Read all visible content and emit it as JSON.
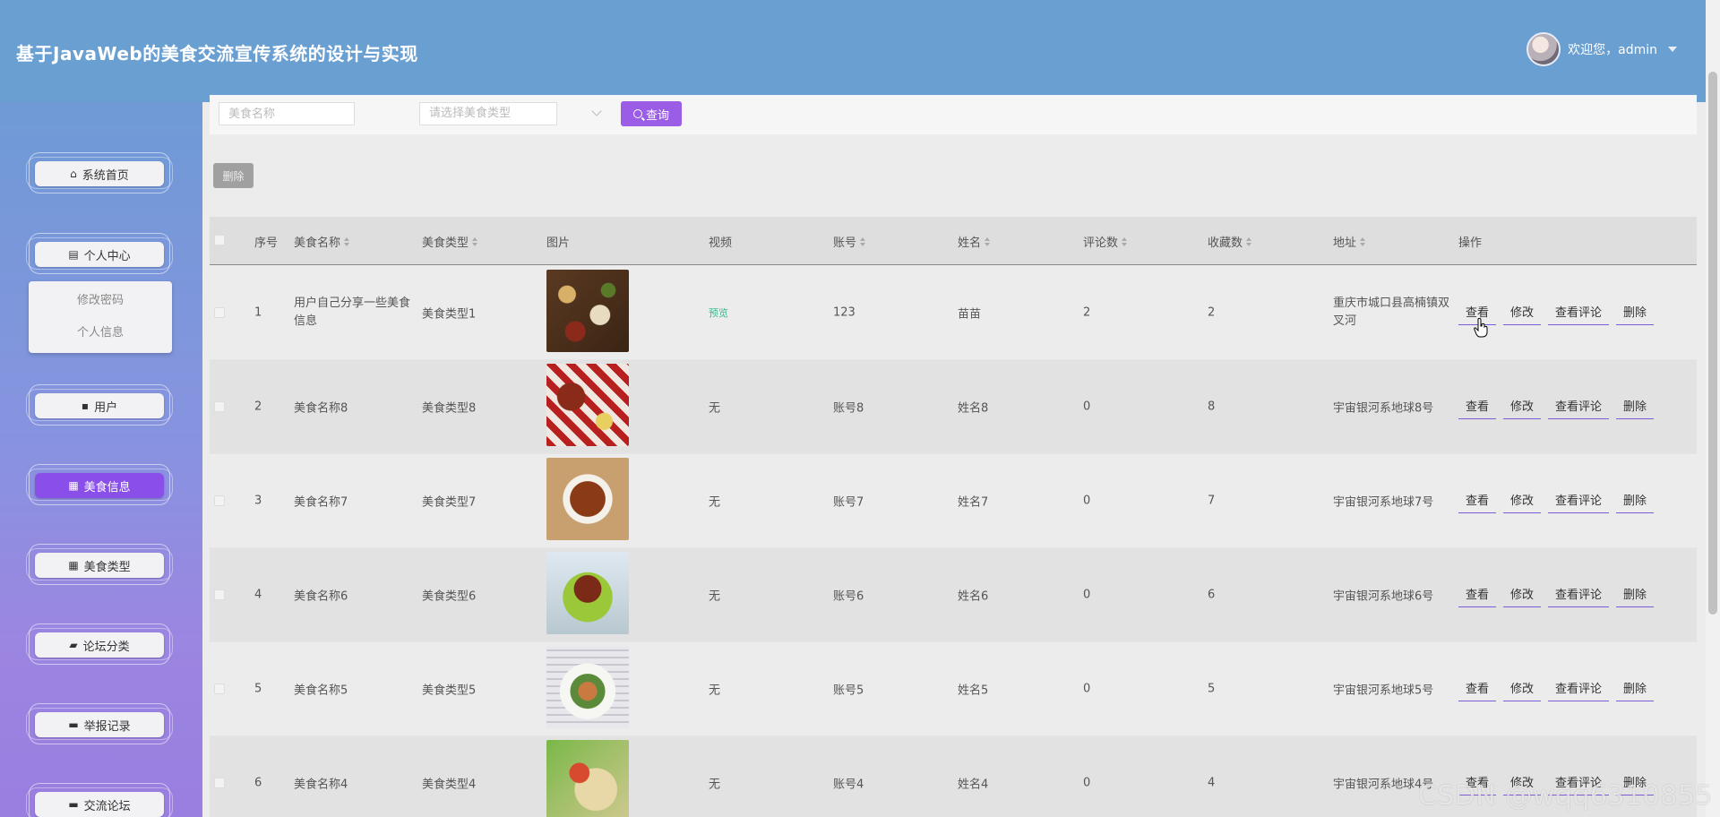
{
  "header": {
    "title": "基于JavaWeb的美食交流宣传系统的设计与实现",
    "welcome": "欢迎您，admin"
  },
  "sidebar": {
    "items": [
      {
        "label": "系统首页",
        "icon": "home-icon"
      },
      {
        "label": "个人中心",
        "icon": "card-icon"
      },
      {
        "label": "用户",
        "icon": "chat-icon"
      },
      {
        "label": "美食信息",
        "icon": "grid-icon",
        "active": true
      },
      {
        "label": "美食类型",
        "icon": "grid-icon"
      },
      {
        "label": "论坛分类",
        "icon": "thumb-icon"
      },
      {
        "label": "举报记录",
        "icon": "monitor-icon"
      },
      {
        "label": "交流论坛",
        "icon": "monitor-icon"
      }
    ],
    "submenu": [
      "修改密码",
      "个人信息"
    ]
  },
  "search": {
    "name_placeholder": "美食名称",
    "type_placeholder": "请选择美食类型",
    "query_label": "查询"
  },
  "toolbar": {
    "delete_label": "删除"
  },
  "table": {
    "headers": [
      "序号",
      "美食名称",
      "美食类型",
      "图片",
      "视频",
      "账号",
      "姓名",
      "评论数",
      "收藏数",
      "地址",
      "操作"
    ],
    "rows": [
      {
        "no": "1",
        "name": "用户自己分享一些美食信息",
        "type": "美食类型1",
        "video": "预览",
        "account": "123",
        "person": "苗苗",
        "comments": "2",
        "favorites": "2",
        "address": "重庆市城口县高楠镇双叉河"
      },
      {
        "no": "2",
        "name": "美食名称8",
        "type": "美食类型8",
        "video": "无",
        "account": "账号8",
        "person": "姓名8",
        "comments": "0",
        "favorites": "8",
        "address": "宇宙银河系地球8号"
      },
      {
        "no": "3",
        "name": "美食名称7",
        "type": "美食类型7",
        "video": "无",
        "account": "账号7",
        "person": "姓名7",
        "comments": "0",
        "favorites": "7",
        "address": "宇宙银河系地球7号"
      },
      {
        "no": "4",
        "name": "美食名称6",
        "type": "美食类型6",
        "video": "无",
        "account": "账号6",
        "person": "姓名6",
        "comments": "0",
        "favorites": "6",
        "address": "宇宙银河系地球6号"
      },
      {
        "no": "5",
        "name": "美食名称5",
        "type": "美食类型5",
        "video": "无",
        "account": "账号5",
        "person": "姓名5",
        "comments": "0",
        "favorites": "5",
        "address": "宇宙银河系地球5号"
      },
      {
        "no": "6",
        "name": "美食名称4",
        "type": "美食类型4",
        "video": "无",
        "account": "账号4",
        "person": "姓名4",
        "comments": "0",
        "favorites": "4",
        "address": "宇宙银河系地球4号"
      }
    ],
    "ops": [
      "查看",
      "修改",
      "查看评论",
      "删除"
    ]
  },
  "watermark": "CSDN @wqq6310855",
  "colors": {
    "header": "#6a9fd2",
    "accent": "#9b5de5",
    "active_menu": "#8a4fe8",
    "preview": "#3eb88d"
  }
}
